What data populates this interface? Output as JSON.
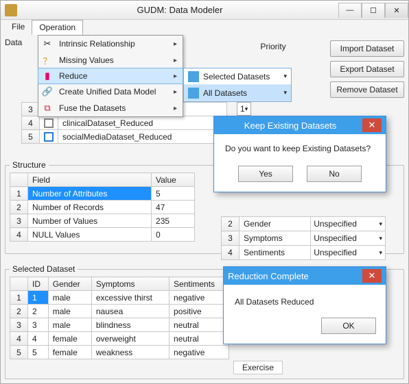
{
  "window": {
    "title": "GUDM: Data Modeler",
    "min_label": "—",
    "max_label": "☐",
    "close_label": "✕"
  },
  "menubar": {
    "file": "File",
    "operation": "Operation",
    "data": "Data"
  },
  "operation_menu": {
    "items": [
      {
        "label": "Intrinsic Relationship",
        "icon": "✂"
      },
      {
        "label": "Missing Values",
        "icon": "？"
      },
      {
        "label": "Reduce",
        "icon": "▮"
      },
      {
        "label": "Create Unified Data Model",
        "icon": "🔗"
      },
      {
        "label": "Fuse the Datasets",
        "icon": "⧉"
      }
    ],
    "reduce_submenu": {
      "items": [
        "Selected Datasets",
        "All Datasets"
      ]
    }
  },
  "priority_header": "Priority",
  "side_buttons": {
    "import": "Import Dataset",
    "export": "Export Dataset",
    "remove": "Remove Dataset"
  },
  "dataset_table": {
    "rows": [
      {
        "n": "3",
        "name": "",
        "priority": "1"
      },
      {
        "n": "4",
        "name": "clinicalDataset_Reduced",
        "priority": ""
      },
      {
        "n": "5",
        "name": "socialMediaDataset_Reduced",
        "priority": ""
      }
    ]
  },
  "structure": {
    "legend": "Structure",
    "col_field": "Field",
    "col_value": "Value",
    "rows": [
      {
        "n": "1",
        "field": "Number of Attributes",
        "value": "5"
      },
      {
        "n": "2",
        "field": "Number of Records",
        "value": "47"
      },
      {
        "n": "3",
        "field": "Number of Values",
        "value": "235"
      },
      {
        "n": "4",
        "field": "NULL Values",
        "value": "0"
      }
    ],
    "right_rows": [
      {
        "n": "2",
        "field": "Gender",
        "value": "Unspecified"
      },
      {
        "n": "3",
        "field": "Symptoms",
        "value": "Unspecified"
      },
      {
        "n": "4",
        "field": "Sentiments",
        "value": "Unspecified"
      }
    ]
  },
  "selected": {
    "legend": "Selected Dataset",
    "cols": {
      "id": "ID",
      "gender": "Gender",
      "symptoms": "Symptoms",
      "sentiments": "Sentiments"
    },
    "rows": [
      {
        "n": "1",
        "id": "1",
        "gender": "male",
        "symptoms": "excessive thirst",
        "sentiments": "negative"
      },
      {
        "n": "2",
        "id": "2",
        "gender": "male",
        "symptoms": "nausea",
        "sentiments": "positive"
      },
      {
        "n": "3",
        "id": "3",
        "gender": "male",
        "symptoms": "blindness",
        "sentiments": "neutral"
      },
      {
        "n": "4",
        "id": "4",
        "gender": "female",
        "symptoms": "overweight",
        "sentiments": "neutral"
      },
      {
        "n": "5",
        "id": "5",
        "gender": "female",
        "symptoms": "weakness",
        "sentiments": "negative"
      }
    ],
    "extra_cell": "Exercise"
  },
  "dialog_keep": {
    "title": "Keep Existing Datasets",
    "message": "Do you want to keep Existing Datasets?",
    "yes": "Yes",
    "no": "No"
  },
  "dialog_reduce": {
    "title": "Reduction Complete",
    "message": "All Datasets Reduced",
    "ok": "OK"
  }
}
